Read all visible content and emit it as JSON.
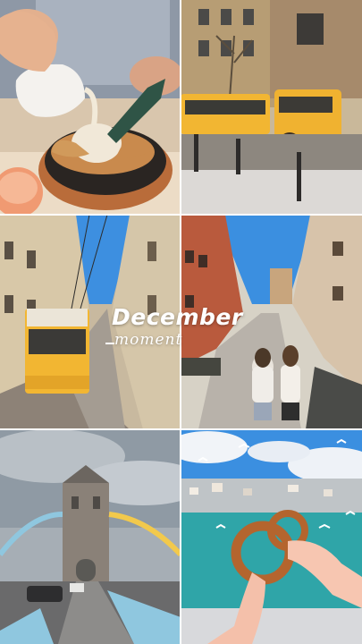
{
  "caption": {
    "title": "December",
    "subtitle": "moment"
  },
  "tiles": [
    {
      "name": "dessert-pour-photo"
    },
    {
      "name": "yellow-tour-train-photo"
    },
    {
      "name": "yellow-tram-street-photo"
    },
    {
      "name": "city-street-walk-photo"
    },
    {
      "name": "tower-bridge-photo"
    },
    {
      "name": "simit-seagulls-photo"
    }
  ],
  "colors": {
    "tram_yellow": "#f2b632",
    "sky_blue": "#3b8fe0",
    "sea_teal": "#2fa5a8",
    "bridge_blue": "#8fc7df"
  }
}
